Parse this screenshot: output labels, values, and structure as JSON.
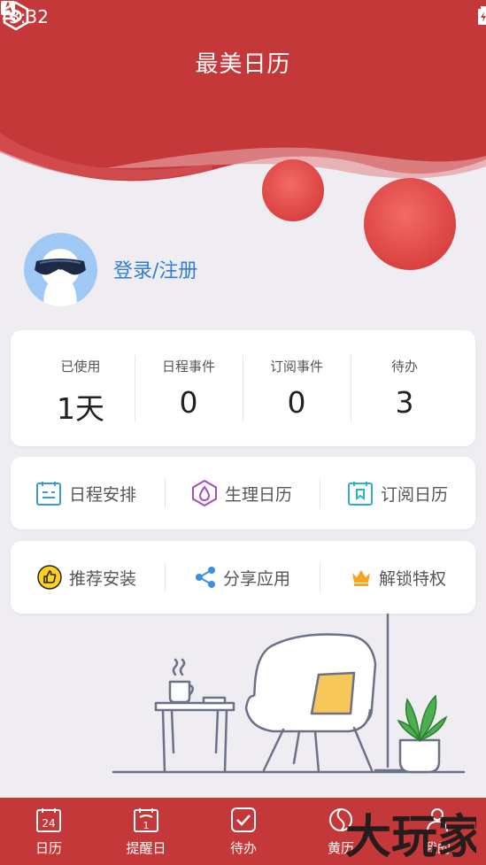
{
  "status_bar": {
    "time": "3:32"
  },
  "header": {
    "title": "最美日历"
  },
  "profile": {
    "login_label": "登录/注册"
  },
  "stats": [
    {
      "label": "已使用",
      "value": "1天"
    },
    {
      "label": "日程事件",
      "value": "0"
    },
    {
      "label": "订阅事件",
      "value": "0"
    },
    {
      "label": "待办",
      "value": "3"
    }
  ],
  "features_row1": [
    {
      "label": "日程安排",
      "icon": "schedule-icon"
    },
    {
      "label": "生理日历",
      "icon": "droplet-icon"
    },
    {
      "label": "订阅日历",
      "icon": "bookmark-calendar-icon"
    }
  ],
  "features_row2": [
    {
      "label": "推荐安装",
      "icon": "thumbs-up-icon"
    },
    {
      "label": "分享应用",
      "icon": "share-icon"
    },
    {
      "label": "解锁特权",
      "icon": "crown-icon"
    }
  ],
  "bottom_nav": [
    {
      "label": "日历",
      "icon": "calendar-icon",
      "day": "24"
    },
    {
      "label": "提醒日",
      "icon": "reminder-icon",
      "day": "1"
    },
    {
      "label": "待办",
      "icon": "checkbox-icon"
    },
    {
      "label": "黄历",
      "icon": "almanac-icon"
    },
    {
      "label": "我的",
      "icon": "person-icon"
    }
  ],
  "watermark": {
    "text": "大玩家"
  },
  "colors": {
    "brand_red": "#c5383a",
    "link_blue": "#2f7fd2",
    "background": "#efedf1"
  }
}
